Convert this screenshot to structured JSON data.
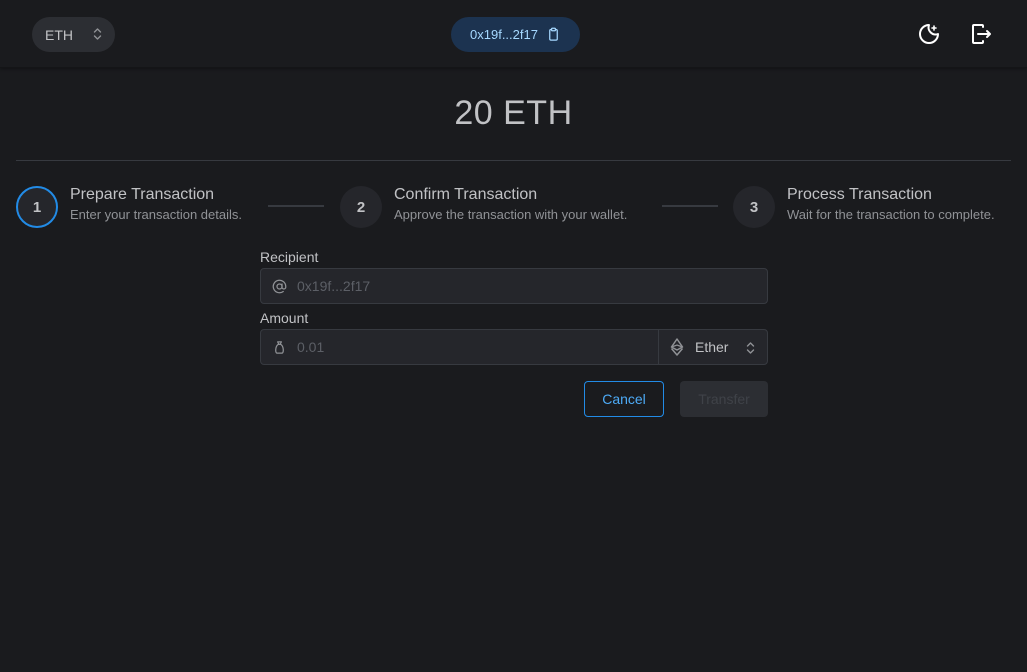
{
  "header": {
    "network": "ETH",
    "address": "0x19f...2f17"
  },
  "balance": "20 ETH",
  "steps": [
    {
      "number": "1",
      "title": "Prepare Transaction",
      "description": "Enter your transaction details."
    },
    {
      "number": "2",
      "title": "Confirm Transaction",
      "description": "Approve the transaction with your wallet."
    },
    {
      "number": "3",
      "title": "Process Transaction",
      "description": "Wait for the transaction to complete."
    }
  ],
  "form": {
    "recipient_label": "Recipient",
    "recipient_placeholder": "0x19f...2f17",
    "amount_label": "Amount",
    "amount_placeholder": "0.01",
    "unit": "Ether",
    "cancel_label": "Cancel",
    "transfer_label": "Transfer"
  },
  "colors": {
    "accent": "#228be6",
    "background": "#1a1b1e",
    "address_pill": "#1c3350"
  }
}
